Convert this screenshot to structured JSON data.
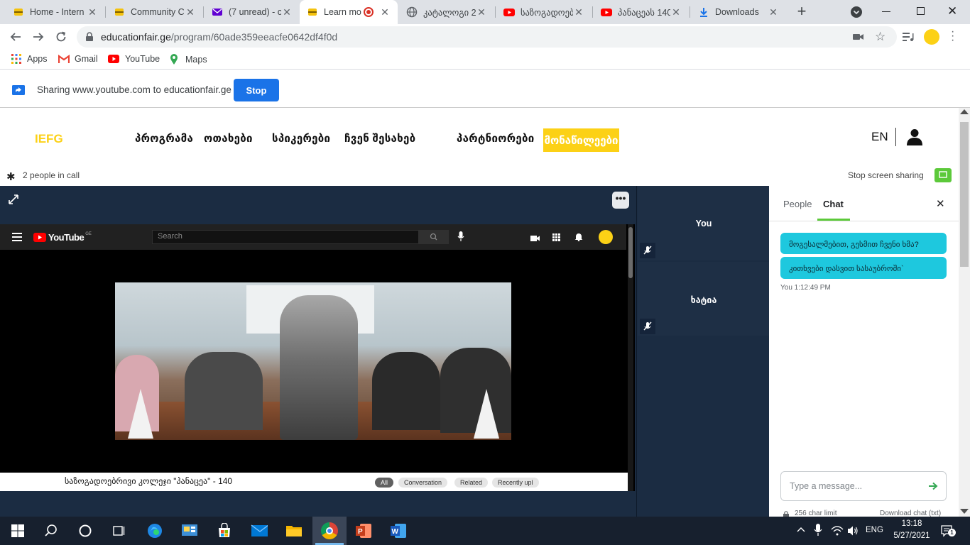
{
  "browser": {
    "tabs": [
      {
        "title": "Home - Intern",
        "icon": "bee-icon",
        "active": false
      },
      {
        "title": "Community C",
        "icon": "bee-icon",
        "active": false
      },
      {
        "title": "(7 unread) - c",
        "icon": "mail-icon",
        "active": false
      },
      {
        "title": "Learn mo",
        "icon": "bee-icon",
        "active": true
      },
      {
        "title": "კატალოგი 2",
        "icon": "globe-icon",
        "active": false
      },
      {
        "title": "საზოგადოებ",
        "icon": "youtube-icon",
        "active": false
      },
      {
        "title": "პანაცეას 140",
        "icon": "youtube-icon",
        "active": false
      },
      {
        "title": "Downloads",
        "icon": "download-icon",
        "active": false
      }
    ],
    "url_host": "educationfair.ge",
    "url_path": "/program/60ade359eeacfe0642df4f0d",
    "bookmarks": [
      {
        "label": "Apps",
        "icon": "apps-grid-icon"
      },
      {
        "label": "Gmail",
        "icon": "gmail-icon"
      },
      {
        "label": "YouTube",
        "icon": "youtube-icon"
      },
      {
        "label": "Maps",
        "icon": "maps-pin-icon"
      }
    ]
  },
  "sharing": {
    "text": "Sharing www.youtube.com to educationfair.ge",
    "stop_label": "Stop"
  },
  "site": {
    "logo": "IEFG",
    "nav": [
      "პროგრამა",
      "ოთახები",
      "სპიკერები",
      "ჩვენ შესახებ",
      "პარტნიორები"
    ],
    "nav_highlight": "მონაწილეები",
    "lang": "EN",
    "call": {
      "people_count": "2 people in call",
      "stop_sharing": "Stop screen sharing"
    },
    "youtube": {
      "logo": "YouTube",
      "region": "GE",
      "search_placeholder": "Search",
      "video_title": "საზოგადოებრივი კოლეჯი \"პანაცეა\" - 140",
      "chips": [
        "All",
        "Conversation",
        "Related",
        "Recently upl"
      ]
    },
    "participants": [
      {
        "name": "You"
      },
      {
        "name": "ხატია"
      }
    ],
    "chat": {
      "tabs": [
        "People",
        "Chat"
      ],
      "active_tab": "Chat",
      "messages": [
        "მოგესალმებით, გესმით ჩვენი ხმა?",
        "კითხვები დასვით სასაუბროში`"
      ],
      "meta": "You 1:12:49 PM",
      "input_placeholder": "Type a message...",
      "char_limit": "256 char limit",
      "download": "Download chat (txt)"
    }
  },
  "taskbar": {
    "lang": "ENG",
    "time": "13:18",
    "date": "5/27/2021",
    "notifications": "1"
  },
  "colors": {
    "accent_yellow": "#fcd116",
    "chat_bubble": "#1ec8de",
    "share_stop": "#1a73e8",
    "dark_panel": "#1b2c42",
    "tile": "#1e2f45"
  }
}
